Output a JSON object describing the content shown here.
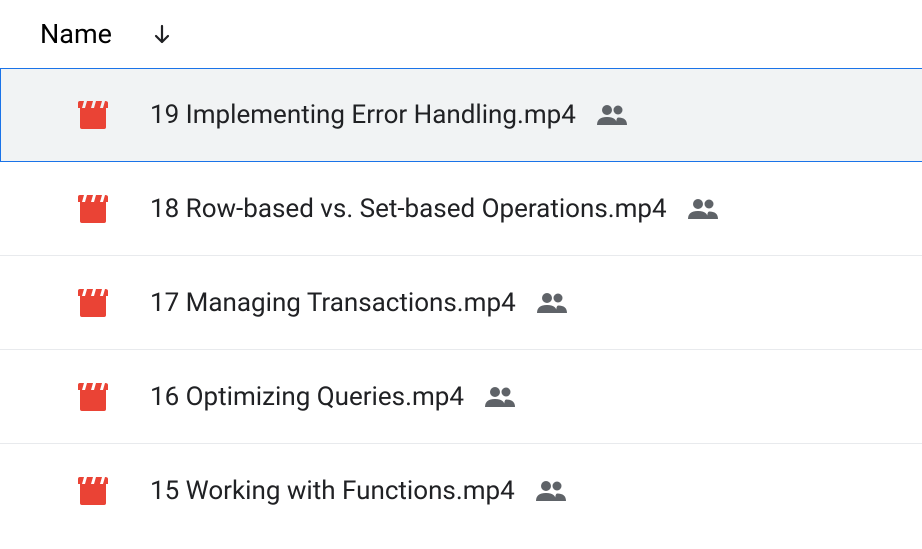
{
  "header": {
    "column_label": "Name",
    "sort_direction": "down"
  },
  "files": [
    {
      "name": "19 Implementing Error Handling.mp4",
      "type": "video",
      "shared": true,
      "selected": true
    },
    {
      "name": "18 Row-based vs. Set-based Operations.mp4",
      "type": "video",
      "shared": true,
      "selected": false
    },
    {
      "name": "17 Managing Transactions.mp4",
      "type": "video",
      "shared": true,
      "selected": false
    },
    {
      "name": "16 Optimizing Queries.mp4",
      "type": "video",
      "shared": true,
      "selected": false
    },
    {
      "name": "15 Working with Functions.mp4",
      "type": "video",
      "shared": true,
      "selected": false
    }
  ]
}
